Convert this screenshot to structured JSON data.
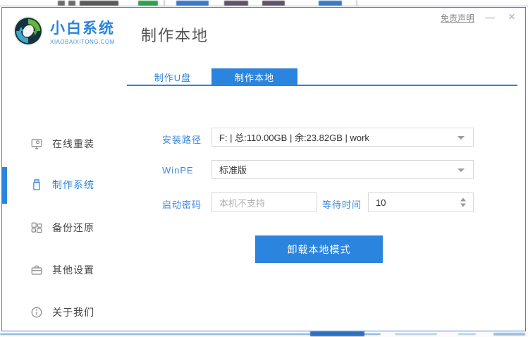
{
  "window": {
    "disclaimer_label": "免责声明",
    "minimize_glyph": "—",
    "close_glyph": "×"
  },
  "brand": {
    "name": "小白系统",
    "domain": "XIAOBAIXITONG.COM"
  },
  "header": {
    "title": "制作本地"
  },
  "sidebar": {
    "items": [
      {
        "label": "在线重装",
        "icon": "monitor-icon",
        "active": false
      },
      {
        "label": "制作系统",
        "icon": "usb-drive-icon",
        "active": true
      },
      {
        "label": "备份还原",
        "icon": "backup-grid-icon",
        "active": false
      },
      {
        "label": "其他设置",
        "icon": "toolbox-icon",
        "active": false
      },
      {
        "label": "关于我们",
        "icon": "info-icon",
        "active": false
      }
    ]
  },
  "tabs": [
    {
      "label": "制作U盘",
      "active": false
    },
    {
      "label": "制作本地",
      "active": true
    }
  ],
  "form": {
    "install_path": {
      "label": "安装路径",
      "value": "F: | 总:110.00GB | 余:23.82GB | work"
    },
    "winpe": {
      "label": "WinPE",
      "value": "标准版"
    },
    "boot_password": {
      "label": "启动密码",
      "placeholder": "本机不支持",
      "value": ""
    },
    "wait_time": {
      "label": "等待时间",
      "value": "10"
    }
  },
  "actions": {
    "uninstall_local_label": "卸载本地模式"
  },
  "colors": {
    "accent": "#2b84dd",
    "label_blue": "#3d87d8",
    "window_border": "#4a86c8"
  }
}
